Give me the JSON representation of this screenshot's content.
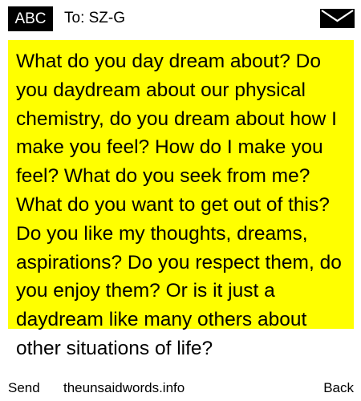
{
  "header": {
    "mode": "ABC",
    "recipient": "To: SZ-G",
    "icon": "envelope-icon"
  },
  "message": {
    "highlight_color": "#ffff00",
    "text": "What do you day dream about? Do you daydream about our physical chemistry, do you dream about how I make you feel? How do I make you feel? What do you seek from me? What do you want to get out of this? Do you like my thoughts, dreams, aspirations? Do you respect them, do you enjoy them? Or is it just a daydream like many others about other situations of life?"
  },
  "footer": {
    "send_label": "Send",
    "site": "theunsaidwords.info",
    "back_label": "Back"
  }
}
